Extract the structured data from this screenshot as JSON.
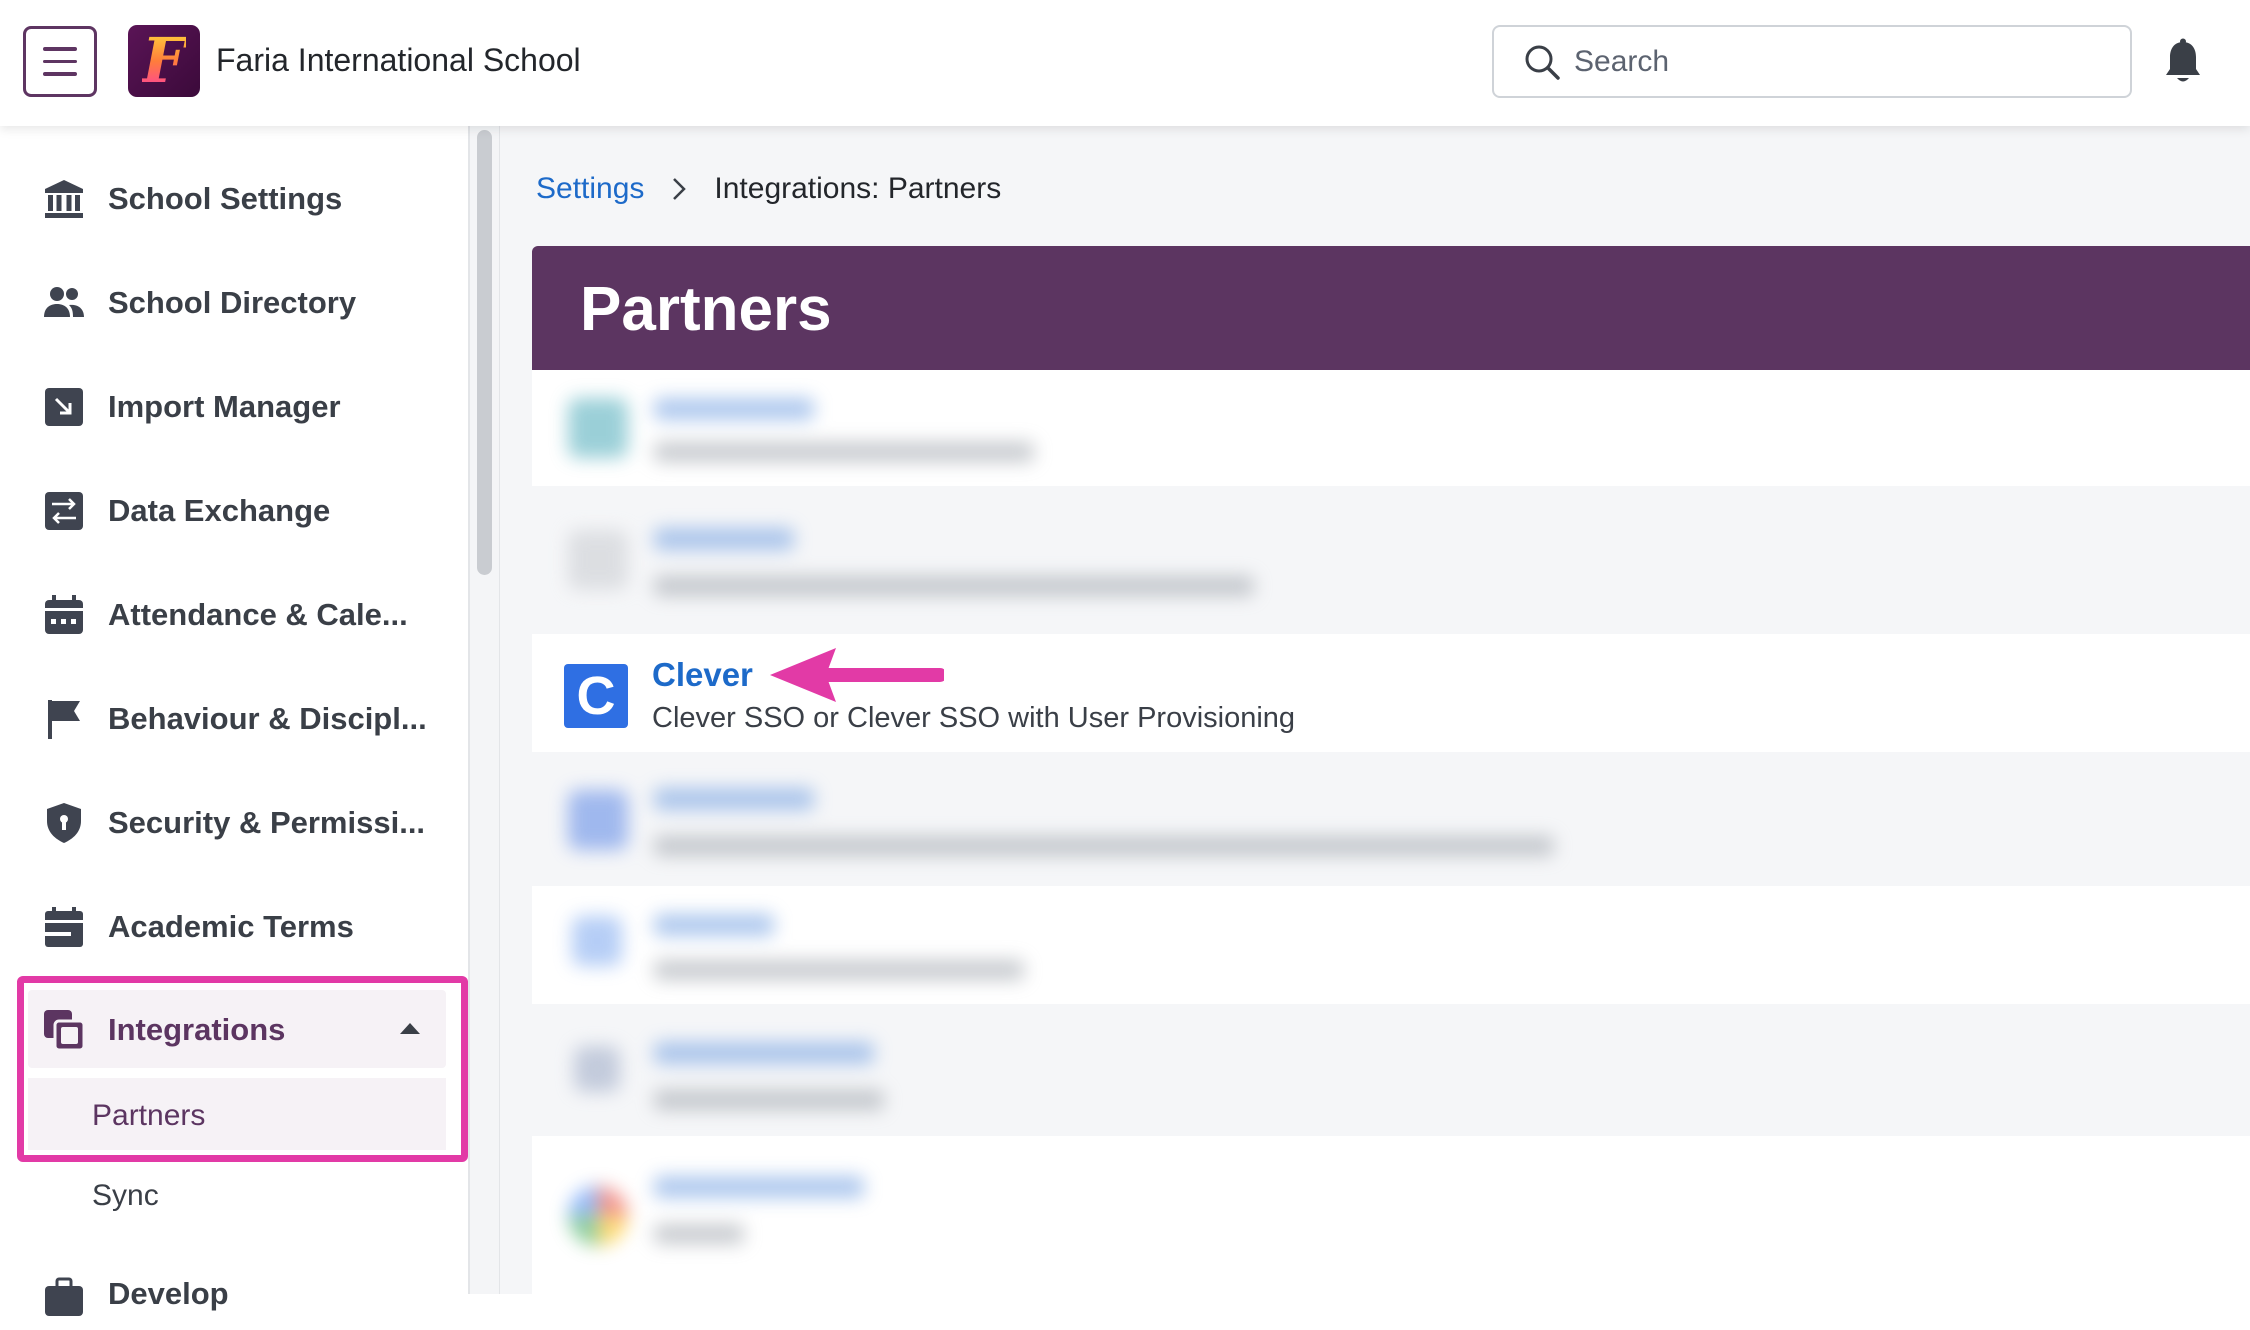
{
  "topbar": {
    "menu_icon": "hamburger-icon",
    "logo_letter": "F",
    "school_name": "Faria International School",
    "search_placeholder": "Search",
    "search_icon": "search-icon",
    "notification_icon": "bell-icon"
  },
  "sidebar": {
    "items": [
      {
        "label": "School Settings",
        "icon": "bank-icon"
      },
      {
        "label": "School Directory",
        "icon": "people-icon"
      },
      {
        "label": "Import Manager",
        "icon": "import-icon"
      },
      {
        "label": "Data Exchange",
        "icon": "exchange-icon"
      },
      {
        "label": "Attendance & Cale...",
        "icon": "calendar-icon"
      },
      {
        "label": "Behaviour & Discipl...",
        "icon": "flag-icon"
      },
      {
        "label": "Security & Permissi...",
        "icon": "shield-icon"
      },
      {
        "label": "Academic Terms",
        "icon": "terms-icon"
      },
      {
        "label": "Integrations",
        "icon": "integrations-icon",
        "expanded": true
      }
    ],
    "sub_items": [
      "Partners",
      "Sync"
    ],
    "next_item_partial": "Develop",
    "highlight_color": "#e23aa6"
  },
  "breadcrumb": {
    "link": "Settings",
    "current": "Integrations: Partners"
  },
  "page": {
    "title": "Partners",
    "header_color": "#5c3561"
  },
  "partners": {
    "featured": {
      "name": "Clever",
      "icon_letter": "C",
      "description": "Clever SSO or Clever SSO with User Provisioning"
    },
    "annotation": "pink-arrow-pointing-at-clever"
  },
  "colors": {
    "link": "#1d6ac9",
    "brand_purple": "#5c3561",
    "clever_blue": "#2f6fe3",
    "annotation_pink": "#e23aa6"
  }
}
